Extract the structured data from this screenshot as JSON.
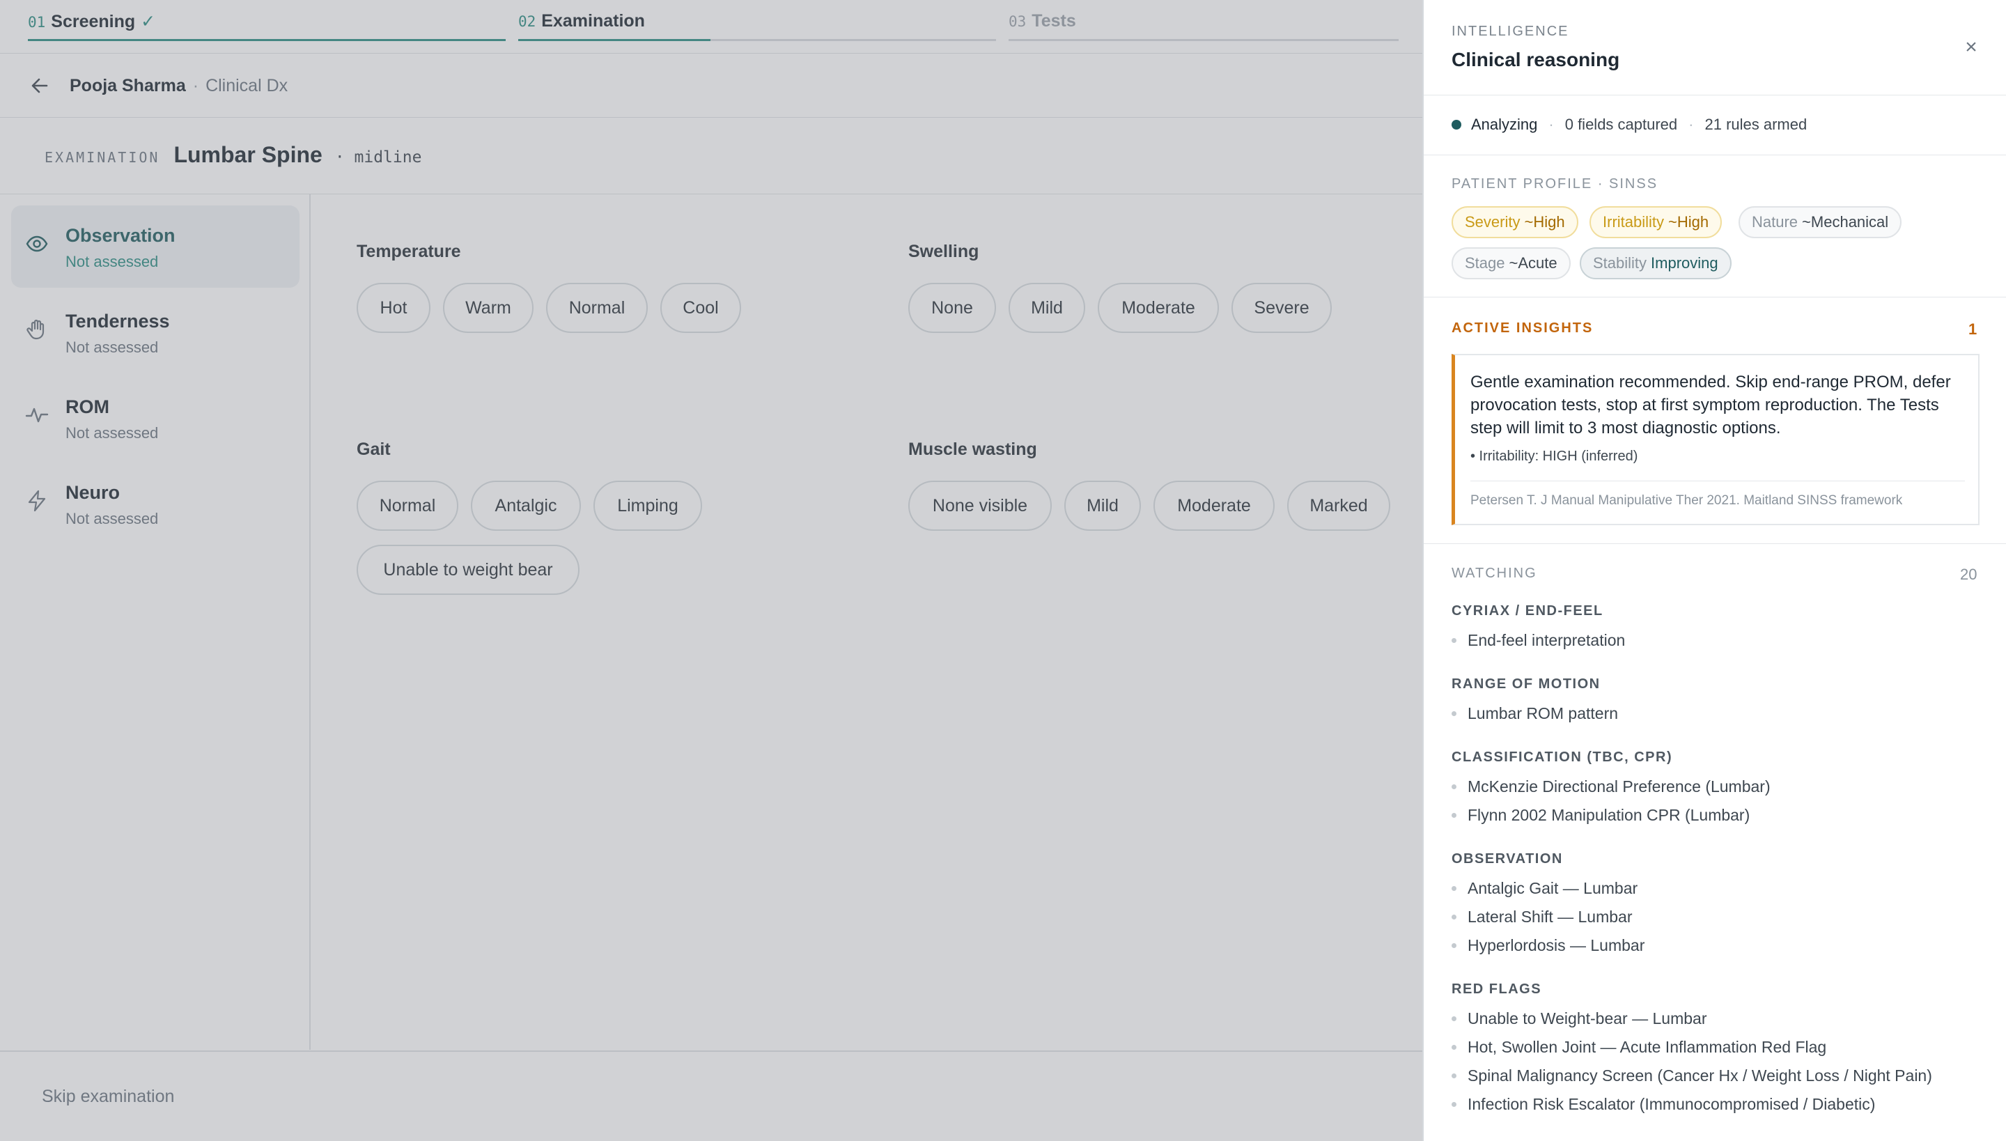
{
  "steps": [
    {
      "num": "01",
      "label": "Screening",
      "done": true
    },
    {
      "num": "02",
      "label": "Examination"
    },
    {
      "num": "03",
      "label": "Tests"
    }
  ],
  "breadcrumb": {
    "patient": "Pooja Sharma",
    "separator": "·",
    "context": "Clinical Dx"
  },
  "exam": {
    "kicker": "EXAMINATION",
    "region": "Lumbar Spine",
    "qualifier": "· midline"
  },
  "nav": [
    {
      "icon": "eye-icon",
      "label": "Observation",
      "status": "Not assessed",
      "active": true
    },
    {
      "icon": "hand-icon",
      "label": "Tenderness",
      "status": "Not assessed"
    },
    {
      "icon": "pulse-icon",
      "label": "ROM",
      "status": "Not assessed"
    },
    {
      "icon": "lightning-icon",
      "label": "Neuro",
      "status": "Not assessed"
    }
  ],
  "groups": [
    {
      "label": "Temperature",
      "options": [
        "Hot",
        "Warm",
        "Normal",
        "Cool"
      ]
    },
    {
      "label": "Swelling",
      "options": [
        "None",
        "Mild",
        "Moderate",
        "Severe"
      ]
    },
    {
      "label": "Gait",
      "options": [
        "Normal",
        "Antalgic",
        "Limping",
        "Unable to weight bear"
      ]
    },
    {
      "label": "Muscle wasting",
      "options": [
        "None visible",
        "Mild",
        "Moderate",
        "Marked"
      ]
    }
  ],
  "footer": {
    "skip_label": "Skip examination"
  },
  "panel": {
    "kicker": "INTELLIGENCE",
    "title": "Clinical reasoning",
    "close_glyph": "×",
    "status": {
      "state": "Analyzing",
      "fields": "0 fields captured",
      "rules": "21 rules armed",
      "separator": "·"
    },
    "profile": {
      "kicker": "PATIENT PROFILE · SINSS",
      "pills": [
        {
          "key": "Severity",
          "value": "~High",
          "tone": "warn"
        },
        {
          "key": "Irritability",
          "value": "~High",
          "tone": "warn"
        },
        {
          "key": "Nature",
          "value": "~Mechanical",
          "tone": "neutral"
        },
        {
          "key": "Stage",
          "value": "~Acute",
          "tone": "neutral"
        },
        {
          "key": "Stability",
          "value": "Improving",
          "tone": "good"
        }
      ]
    },
    "insights": {
      "kicker": "ACTIVE INSIGHTS",
      "count": "1",
      "items": [
        {
          "text": "Gentle examination recommended. Skip end-range PROM, defer provocation tests, stop at first symptom reproduction. The Tests step will limit to 3 most diagnostic options.",
          "bullet": "• Irritability: HIGH (inferred)",
          "source": "Petersen T. J Manual Manipulative Ther 2021. Maitland SINSS framework"
        }
      ]
    },
    "watching": {
      "kicker": "WATCHING",
      "count": "20",
      "sections": [
        {
          "title": "CYRIAX / END-FEEL",
          "items": [
            "End-feel interpretation"
          ]
        },
        {
          "title": "RANGE OF MOTION",
          "items": [
            "Lumbar ROM pattern"
          ]
        },
        {
          "title": "CLASSIFICATION (TBC, CPR)",
          "items": [
            "McKenzie Directional Preference (Lumbar)",
            "Flynn 2002 Manipulation CPR (Lumbar)"
          ]
        },
        {
          "title": "OBSERVATION",
          "items": [
            "Antalgic Gait — Lumbar",
            "Lateral Shift — Lumbar",
            "Hyperlordosis — Lumbar"
          ]
        },
        {
          "title": "RED FLAGS",
          "items": [
            "Unable to Weight-bear — Lumbar",
            "Hot, Swollen Joint — Acute Inflammation Red Flag",
            "Spinal Malignancy Screen (Cancer Hx / Weight Loss / Night Pain)",
            "Infection Risk Escalator (Immunocompromised / Diabetic)"
          ]
        }
      ]
    }
  },
  "colors": {
    "accent": "#2a8c82",
    "warning": "#c2650c",
    "dark_teal": "#1f5c5f"
  }
}
